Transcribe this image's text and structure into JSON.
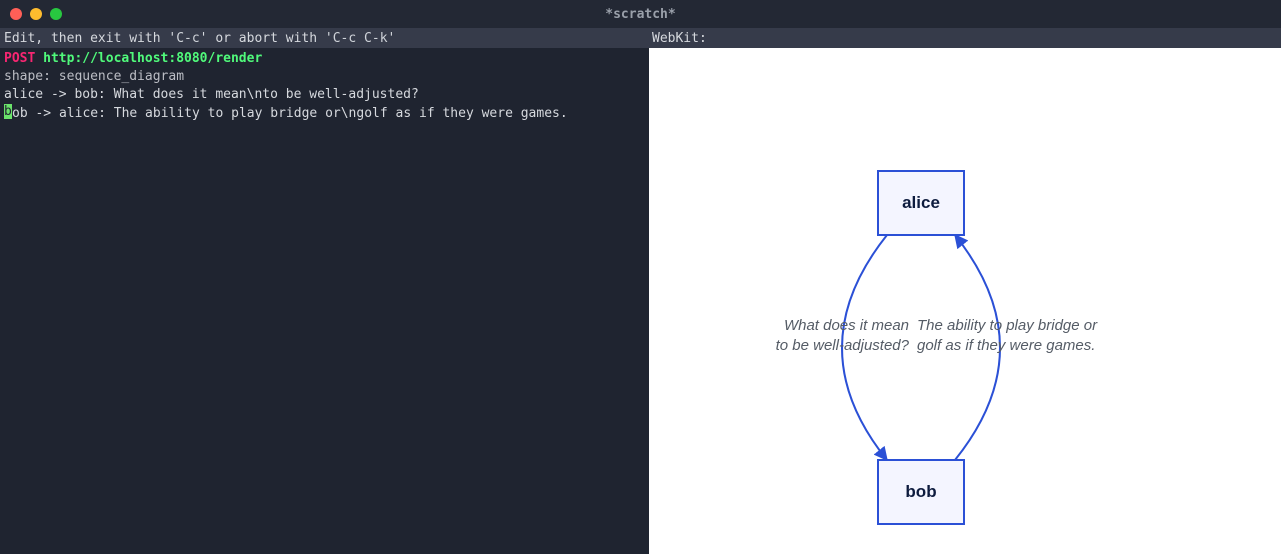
{
  "window": {
    "title": "*scratch*"
  },
  "statusbar": {
    "left": {
      "prefix": "Edit, then exit with '",
      "kbd1": "C-c ",
      "mid": "' or abort with '",
      "kbd2": "C-c C-k",
      "suffix": "'"
    },
    "right": "WebKit:"
  },
  "editor": {
    "method": "POST",
    "url": "http://localhost:8080/render",
    "line2_field": "shape:",
    "line2_value": " sequence_diagram",
    "line3": "alice -> bob: What does it mean\\nto be well-adjusted?",
    "line4_firstchar": "b",
    "line4_rest": "ob -> alice: The ability to play bridge or\\ngolf as if they were games."
  },
  "diagram": {
    "node_alice": "alice",
    "node_bob": "bob",
    "edge_left_l1": "What does it mean",
    "edge_left_l2": "to be well-adjusted?",
    "edge_right_l1": "The ability to play bridge or",
    "edge_right_l2": "golf as if they were games."
  },
  "colors": {
    "edge": "#2b50d6"
  }
}
